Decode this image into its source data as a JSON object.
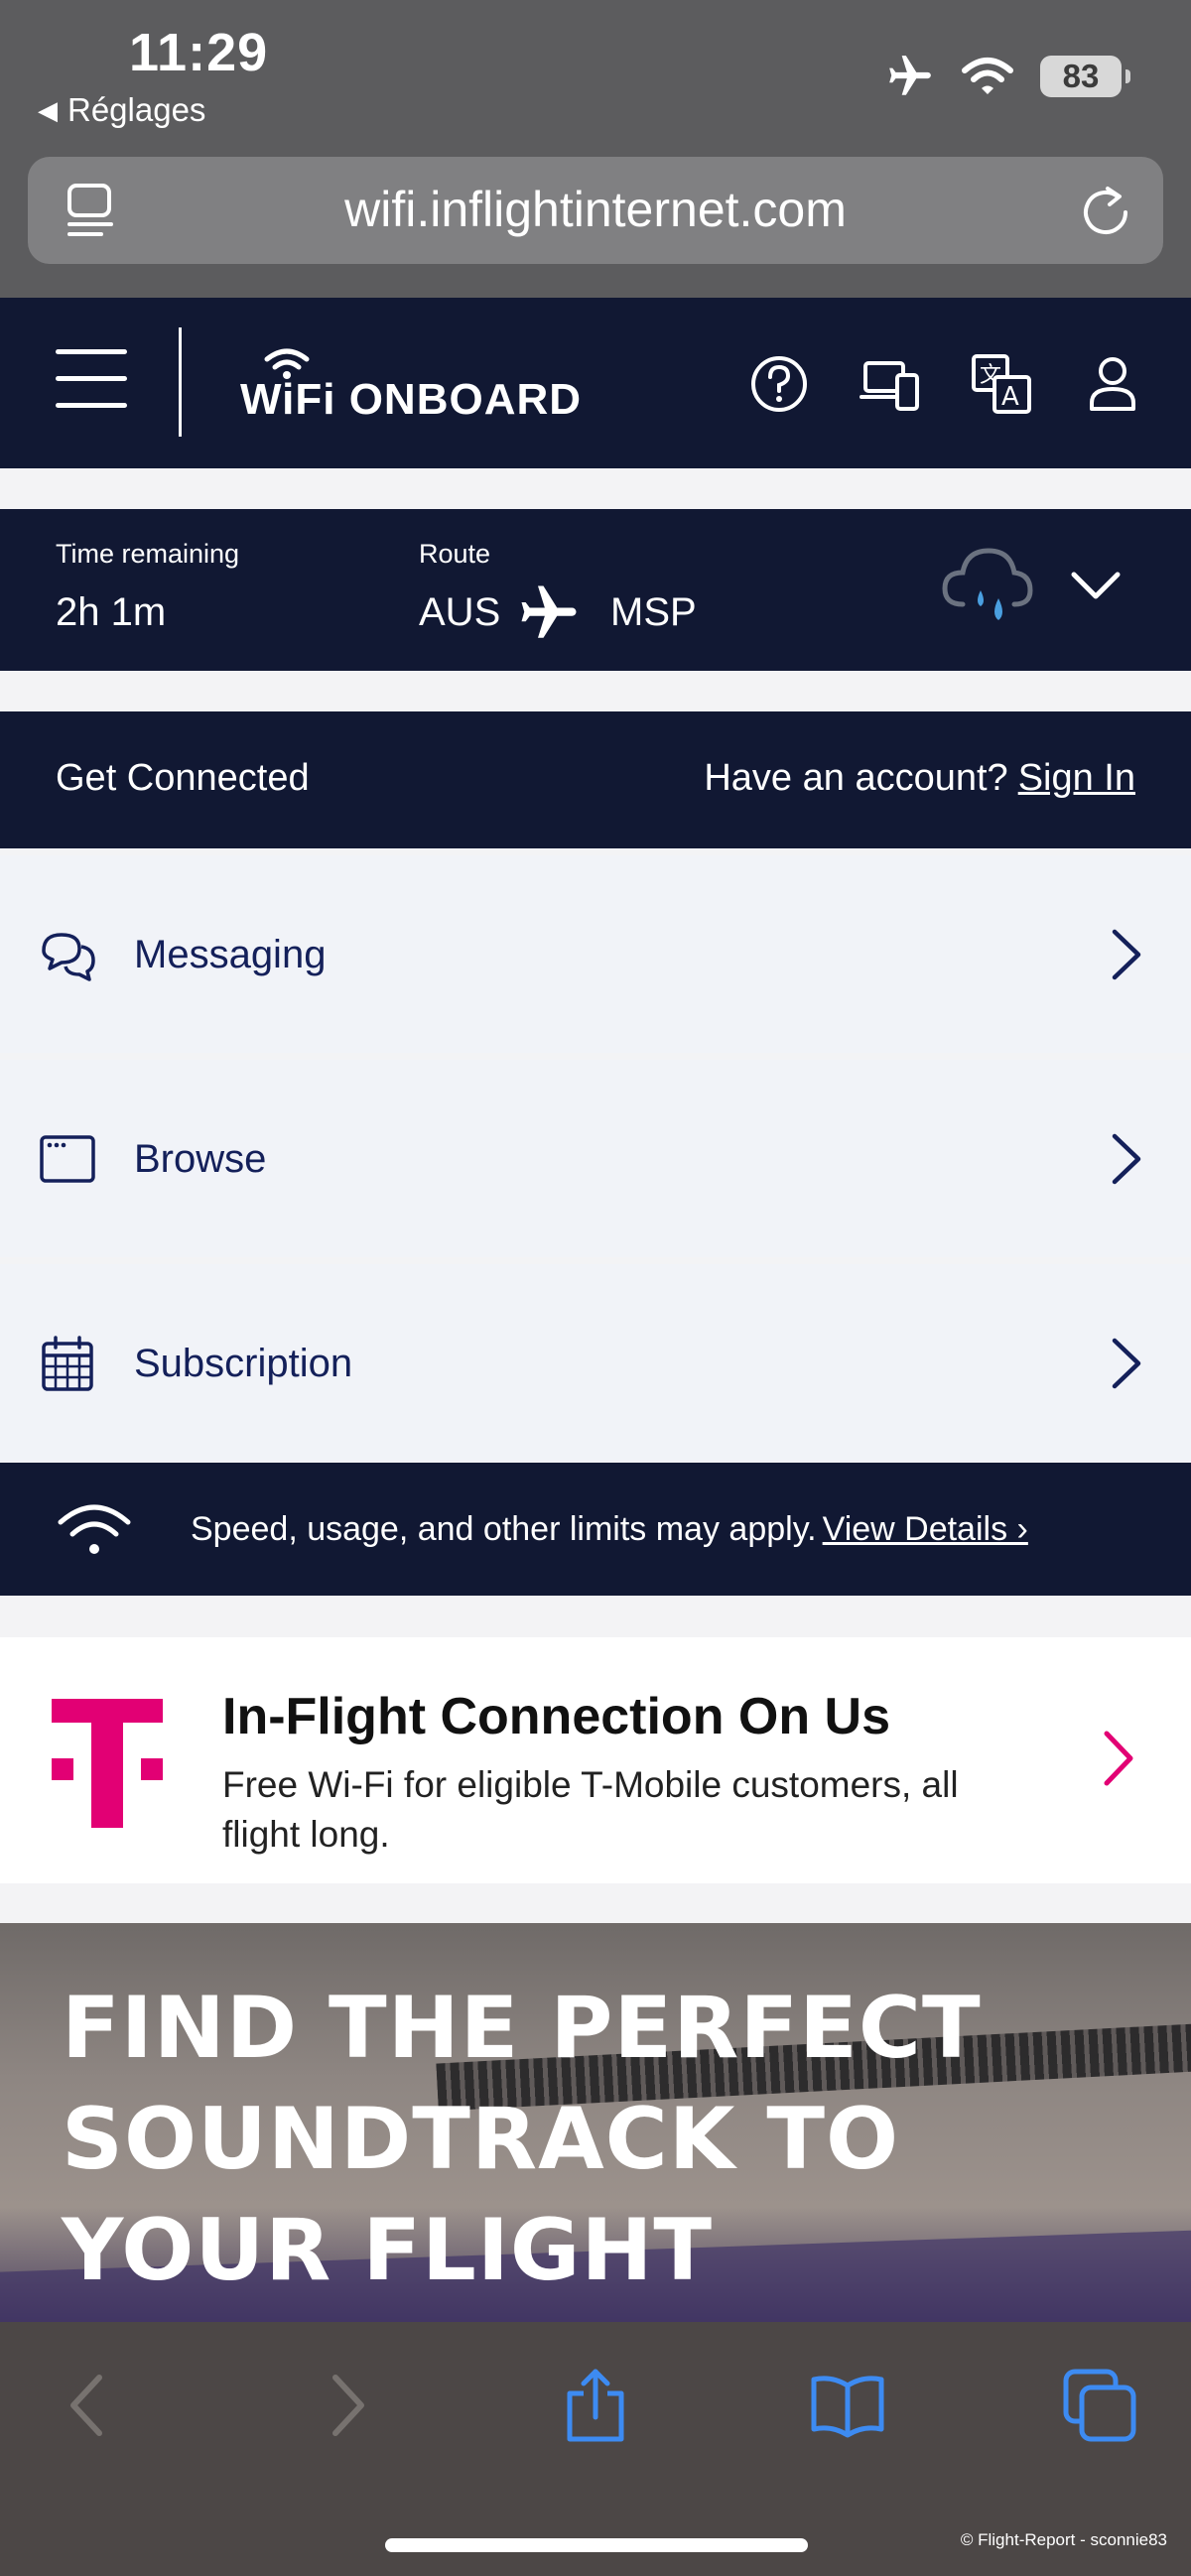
{
  "status_bar": {
    "time": "11:29",
    "back_app": "Réglages",
    "battery": "83"
  },
  "safari": {
    "url": "wifi.inflightinternet.com"
  },
  "header": {
    "logo_text": "WiFi ONBOARD"
  },
  "flight": {
    "time_label": "Time remaining",
    "time_value": "2h 1m",
    "route_label": "Route",
    "origin": "AUS",
    "destination": "MSP"
  },
  "connect": {
    "title": "Get Connected",
    "account_prompt": "Have an account?",
    "sign_in": "Sign In"
  },
  "menu": [
    {
      "label": "Messaging",
      "icon": "chat-bubbles-icon"
    },
    {
      "label": "Browse",
      "icon": "browser-window-icon"
    },
    {
      "label": "Subscription",
      "icon": "calendar-icon"
    }
  ],
  "limits": {
    "text": "Speed, usage, and other limits may apply.",
    "link": "View Details ›"
  },
  "promo": {
    "title": "In-Flight Connection On Us",
    "description": "Free Wi-Fi for eligible T-Mobile customers, all flight long."
  },
  "banner": {
    "line1": "FIND THE PERFECT",
    "line2": "SOUNDTRACK TO",
    "line3": "YOUR FLIGHT"
  },
  "credit": "© Flight-Report - sconnie83",
  "colors": {
    "navy": "#111833",
    "menu_text": "#14205a",
    "tmobile_magenta": "#e20074",
    "safari_blue": "#3d8bf2"
  }
}
